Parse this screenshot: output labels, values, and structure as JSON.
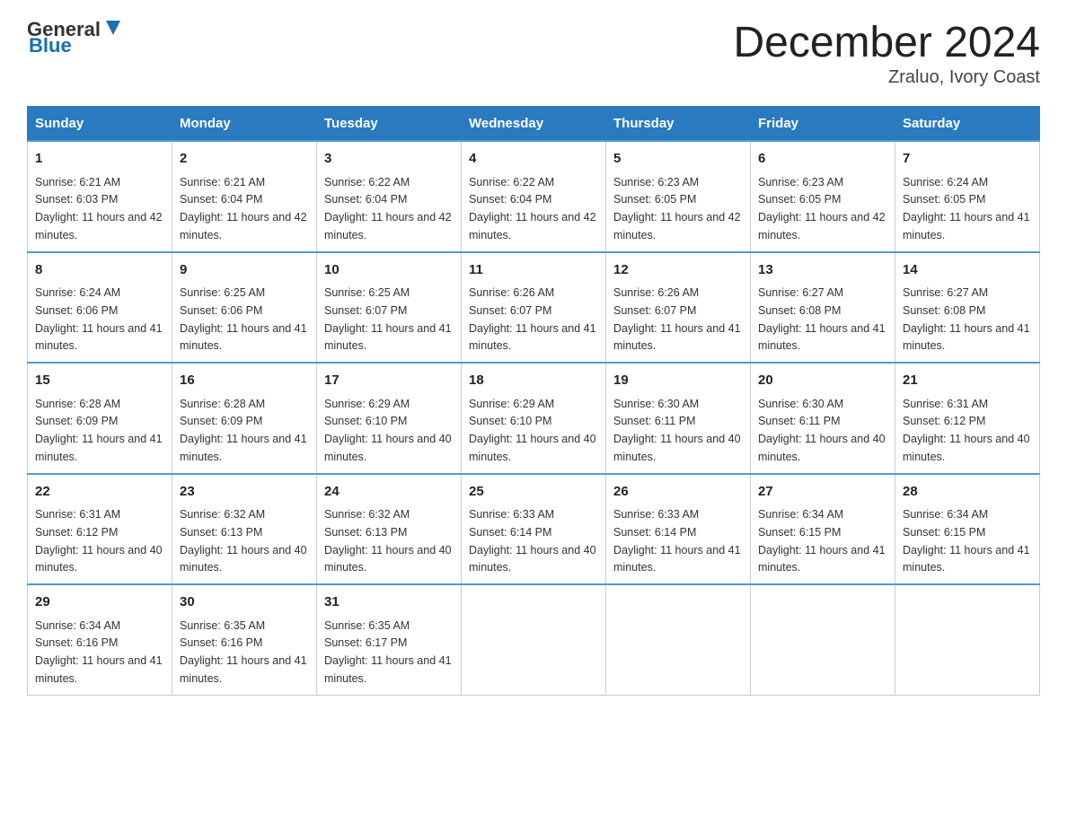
{
  "header": {
    "logo_general": "General",
    "logo_blue": "Blue",
    "title": "December 2024",
    "subtitle": "Zraluo, Ivory Coast"
  },
  "weekdays": [
    "Sunday",
    "Monday",
    "Tuesday",
    "Wednesday",
    "Thursday",
    "Friday",
    "Saturday"
  ],
  "weeks": [
    [
      {
        "day": "1",
        "sunrise": "6:21 AM",
        "sunset": "6:03 PM",
        "daylight": "11 hours and 42 minutes."
      },
      {
        "day": "2",
        "sunrise": "6:21 AM",
        "sunset": "6:04 PM",
        "daylight": "11 hours and 42 minutes."
      },
      {
        "day": "3",
        "sunrise": "6:22 AM",
        "sunset": "6:04 PM",
        "daylight": "11 hours and 42 minutes."
      },
      {
        "day": "4",
        "sunrise": "6:22 AM",
        "sunset": "6:04 PM",
        "daylight": "11 hours and 42 minutes."
      },
      {
        "day": "5",
        "sunrise": "6:23 AM",
        "sunset": "6:05 PM",
        "daylight": "11 hours and 42 minutes."
      },
      {
        "day": "6",
        "sunrise": "6:23 AM",
        "sunset": "6:05 PM",
        "daylight": "11 hours and 42 minutes."
      },
      {
        "day": "7",
        "sunrise": "6:24 AM",
        "sunset": "6:05 PM",
        "daylight": "11 hours and 41 minutes."
      }
    ],
    [
      {
        "day": "8",
        "sunrise": "6:24 AM",
        "sunset": "6:06 PM",
        "daylight": "11 hours and 41 minutes."
      },
      {
        "day": "9",
        "sunrise": "6:25 AM",
        "sunset": "6:06 PM",
        "daylight": "11 hours and 41 minutes."
      },
      {
        "day": "10",
        "sunrise": "6:25 AM",
        "sunset": "6:07 PM",
        "daylight": "11 hours and 41 minutes."
      },
      {
        "day": "11",
        "sunrise": "6:26 AM",
        "sunset": "6:07 PM",
        "daylight": "11 hours and 41 minutes."
      },
      {
        "day": "12",
        "sunrise": "6:26 AM",
        "sunset": "6:07 PM",
        "daylight": "11 hours and 41 minutes."
      },
      {
        "day": "13",
        "sunrise": "6:27 AM",
        "sunset": "6:08 PM",
        "daylight": "11 hours and 41 minutes."
      },
      {
        "day": "14",
        "sunrise": "6:27 AM",
        "sunset": "6:08 PM",
        "daylight": "11 hours and 41 minutes."
      }
    ],
    [
      {
        "day": "15",
        "sunrise": "6:28 AM",
        "sunset": "6:09 PM",
        "daylight": "11 hours and 41 minutes."
      },
      {
        "day": "16",
        "sunrise": "6:28 AM",
        "sunset": "6:09 PM",
        "daylight": "11 hours and 41 minutes."
      },
      {
        "day": "17",
        "sunrise": "6:29 AM",
        "sunset": "6:10 PM",
        "daylight": "11 hours and 40 minutes."
      },
      {
        "day": "18",
        "sunrise": "6:29 AM",
        "sunset": "6:10 PM",
        "daylight": "11 hours and 40 minutes."
      },
      {
        "day": "19",
        "sunrise": "6:30 AM",
        "sunset": "6:11 PM",
        "daylight": "11 hours and 40 minutes."
      },
      {
        "day": "20",
        "sunrise": "6:30 AM",
        "sunset": "6:11 PM",
        "daylight": "11 hours and 40 minutes."
      },
      {
        "day": "21",
        "sunrise": "6:31 AM",
        "sunset": "6:12 PM",
        "daylight": "11 hours and 40 minutes."
      }
    ],
    [
      {
        "day": "22",
        "sunrise": "6:31 AM",
        "sunset": "6:12 PM",
        "daylight": "11 hours and 40 minutes."
      },
      {
        "day": "23",
        "sunrise": "6:32 AM",
        "sunset": "6:13 PM",
        "daylight": "11 hours and 40 minutes."
      },
      {
        "day": "24",
        "sunrise": "6:32 AM",
        "sunset": "6:13 PM",
        "daylight": "11 hours and 40 minutes."
      },
      {
        "day": "25",
        "sunrise": "6:33 AM",
        "sunset": "6:14 PM",
        "daylight": "11 hours and 40 minutes."
      },
      {
        "day": "26",
        "sunrise": "6:33 AM",
        "sunset": "6:14 PM",
        "daylight": "11 hours and 41 minutes."
      },
      {
        "day": "27",
        "sunrise": "6:34 AM",
        "sunset": "6:15 PM",
        "daylight": "11 hours and 41 minutes."
      },
      {
        "day": "28",
        "sunrise": "6:34 AM",
        "sunset": "6:15 PM",
        "daylight": "11 hours and 41 minutes."
      }
    ],
    [
      {
        "day": "29",
        "sunrise": "6:34 AM",
        "sunset": "6:16 PM",
        "daylight": "11 hours and 41 minutes."
      },
      {
        "day": "30",
        "sunrise": "6:35 AM",
        "sunset": "6:16 PM",
        "daylight": "11 hours and 41 minutes."
      },
      {
        "day": "31",
        "sunrise": "6:35 AM",
        "sunset": "6:17 PM",
        "daylight": "11 hours and 41 minutes."
      },
      null,
      null,
      null,
      null
    ]
  ],
  "labels": {
    "sunrise": "Sunrise: ",
    "sunset": "Sunset: ",
    "daylight": "Daylight: "
  }
}
